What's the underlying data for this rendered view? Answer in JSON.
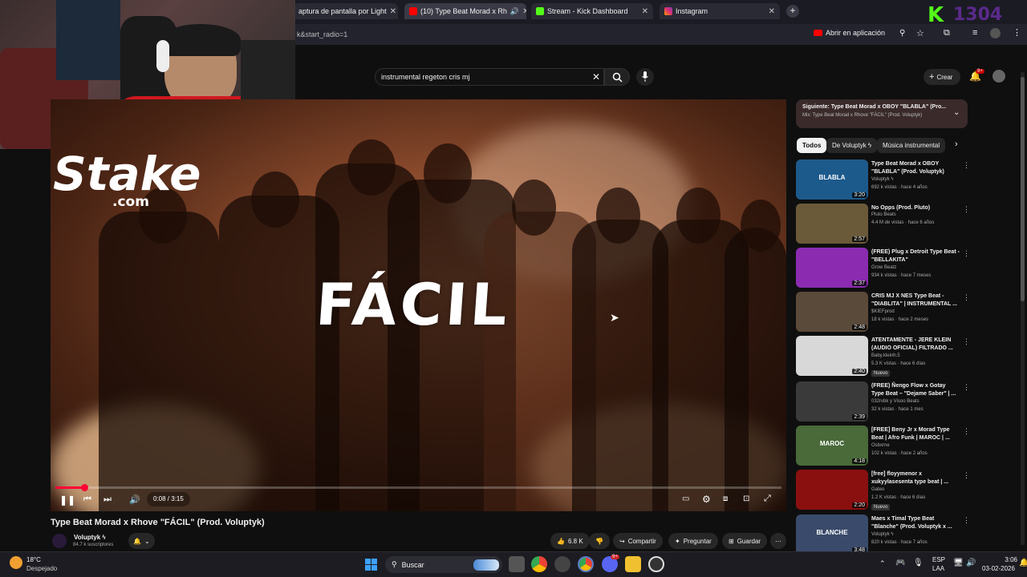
{
  "browser": {
    "tabs": [
      {
        "label": "aptura de pantalla por Light"
      },
      {
        "label": "(10) Type Beat Morad x Rh"
      },
      {
        "label": "Stream - Kick Dashboard"
      },
      {
        "label": "Instagram"
      }
    ],
    "new_tab": "+",
    "url": "k&start_radio=1",
    "open_in_app": "Abrir en aplicación"
  },
  "kick_overlay": {
    "letter": "K",
    "count": "1304"
  },
  "youtube": {
    "search": {
      "value": "instrumental regeton cris mj"
    },
    "create_label": "Crear",
    "notifications_badge": "9+"
  },
  "video": {
    "sponsor_logo": "Stake",
    "sponsor_domain": ".com",
    "overlay_title": "FÁCIL",
    "time": "0:08 / 3:15",
    "progress": 0.04,
    "title": "Type Beat Morad x Rhove \"FÁCIL\" (Prod. Voluptyk)",
    "channel": "Voluptyk ϟ",
    "subscribers": "84.7 k suscriptores",
    "likes": "6.8 K",
    "share": "Compartir",
    "ask": "Preguntar",
    "save": "Guardar"
  },
  "up_next": {
    "title": "Siguiente: Type Beat Morad x OBOY \"BLABLA\" (Pro...",
    "subtitle": "Mix: Type Beat Morad x Rhove \"FÁCIL\" (Prod. Voluptyk)"
  },
  "chips": [
    "Todos",
    "De Voluptyk ϟ",
    "Música instrumental"
  ],
  "recommendations": [
    {
      "title": "Type Beat Morad x OBOY \"BLABLA\" (Prod. Voluptyk)",
      "channel": "Voluptyk ϟ",
      "meta": "692 k vistas · hace 4 años",
      "duration": "3:20",
      "thumb_color": "#1d5a8c",
      "thumb_text": "BLABLA",
      "badge": ""
    },
    {
      "title": "No Opps (Prod. Pluto)",
      "channel": "Pluto Beats",
      "meta": "4.4 M de vistas · hace 6 años",
      "duration": "2:57",
      "thumb_color": "#6a5a3a",
      "thumb_text": "",
      "badge": ""
    },
    {
      "title": "(FREE) Plug x Detroit Type Beat - \"BELLAKITA\"",
      "channel": "Grow Beatz",
      "meta": "934 k vistas · hace 7 meses",
      "duration": "2:37",
      "thumb_color": "#8a2bb0",
      "thumb_text": "",
      "badge": ""
    },
    {
      "title": "CRIS MJ X NES Type Beat - \"DIABLITA\" | INSTRUMENTAL ...",
      "channel": "$KIEFprod",
      "meta": "18 k vistas · hace 2 meses",
      "duration": "2:48",
      "thumb_color": "#5a4a3a",
      "thumb_text": "",
      "badge": ""
    },
    {
      "title": "ATENTAMENTE - JERE KLEIN (AUDIO OFICIAL) FILTRADO ...",
      "channel": "Baby.kleinh.5",
      "meta": "5.3 K vistas · hace 6 días",
      "duration": "2:40",
      "thumb_color": "#d8d8d8",
      "thumb_text": "",
      "badge": "Nuevo"
    },
    {
      "title": "(FREE) Ñengo Flow x Gotay Type Beat – \"Dejame Saber\" | ...",
      "channel": "032rvbk y Visoo Beats",
      "meta": "32 k vistas · hace 1 mes",
      "duration": "2:39",
      "thumb_color": "#3a3a3a",
      "thumb_text": "",
      "badge": ""
    },
    {
      "title": "[FREE] Beny Jr x Morad Type Beat | Afro Funk | MAROC | ...",
      "channel": "Osbxrne",
      "meta": "102 k vistas · hace 2 años",
      "duration": "4:18",
      "thumb_color": "#4a6a3a",
      "thumb_text": "MAROC",
      "badge": ""
    },
    {
      "title": "[free] floyymenor x xukyylasesenta type beat | ...",
      "channel": "Gateo",
      "meta": "1.2 K vistas · hace 6 días",
      "duration": "2:20",
      "thumb_color": "#8a1010",
      "thumb_text": "",
      "badge": "Nuevo"
    },
    {
      "title": "Maes x Timal Type Beat \"Blanche\" (Prod. Voluptyk x ...",
      "channel": "Voluptyk ϟ",
      "meta": "820 k vistas · hace 7 años",
      "duration": "3:48",
      "thumb_color": "#3a4a6a",
      "thumb_text": "BLANCHE",
      "badge": ""
    }
  ],
  "taskbar": {
    "weather_temp": "18°C",
    "weather_desc": "Despejado",
    "search": "Buscar",
    "lang": "ESP",
    "lang2": "LAA",
    "time": "3:06",
    "date": "03-02-2026",
    "discord_badge": "9+"
  }
}
